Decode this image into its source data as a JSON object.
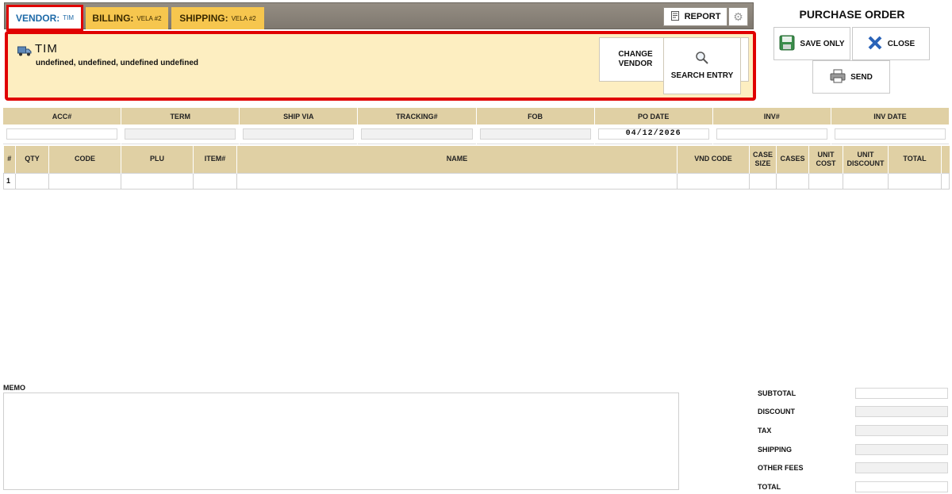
{
  "tabs": {
    "vendor": {
      "label": "VENDOR:",
      "value": "TIM"
    },
    "billing": {
      "label": "BILLING:",
      "value": "VELA #2"
    },
    "shipping": {
      "label": "SHIPPING:",
      "value": "VELA #2"
    }
  },
  "toolbar": {
    "report_label": "REPORT"
  },
  "vendor_panel": {
    "name": "TIM",
    "address": "undefined, undefined, undefined undefined",
    "change_vendor_label": "CHANGE VENDOR",
    "search_entry_label": "SEARCH ENTRY"
  },
  "right": {
    "title": "PURCHASE ORDER",
    "save_label": "SAVE ONLY",
    "close_label": "CLOSE",
    "send_label": "SEND"
  },
  "header_fields": [
    {
      "label": "ACC#",
      "value": ""
    },
    {
      "label": "TERM",
      "value": ""
    },
    {
      "label": "SHIP VIA",
      "value": ""
    },
    {
      "label": "TRACKING#",
      "value": ""
    },
    {
      "label": "FOB",
      "value": ""
    },
    {
      "label": "PO DATE",
      "value": "04/12/2026"
    },
    {
      "label": "INV#",
      "value": ""
    },
    {
      "label": "INV DATE",
      "value": ""
    }
  ],
  "items_table": {
    "columns": [
      "#",
      "QTY",
      "CODE",
      "PLU",
      "ITEM#",
      "NAME",
      "VND CODE",
      "CASE SIZE",
      "CASES",
      "UNIT COST",
      "UNIT DISCOUNT",
      "TOTAL"
    ],
    "rows": [
      [
        "1",
        "",
        "",
        "",
        "",
        "",
        "",
        "",
        "",
        "",
        "",
        ""
      ]
    ]
  },
  "memo": {
    "label": "MEMO",
    "value": ""
  },
  "totals": [
    {
      "label": "SUBTOTAL",
      "value": ""
    },
    {
      "label": "DISCOUNT",
      "value": ""
    },
    {
      "label": "TAX",
      "value": ""
    },
    {
      "label": "SHIPPING",
      "value": ""
    },
    {
      "label": "OTHER FEES",
      "value": ""
    },
    {
      "label": "TOTAL",
      "value": ""
    }
  ],
  "colors": {
    "accent_red": "#e00000",
    "tab_gold": "#f6c64e",
    "header_tan": "#e0d0a4",
    "panel_cream": "#fdeec1",
    "vendor_blue": "#1e6aa8"
  },
  "icons": [
    "truck-icon",
    "report-icon",
    "gear-icon",
    "magnifier-icon",
    "save-icon",
    "close-x-icon",
    "printer-icon"
  ]
}
